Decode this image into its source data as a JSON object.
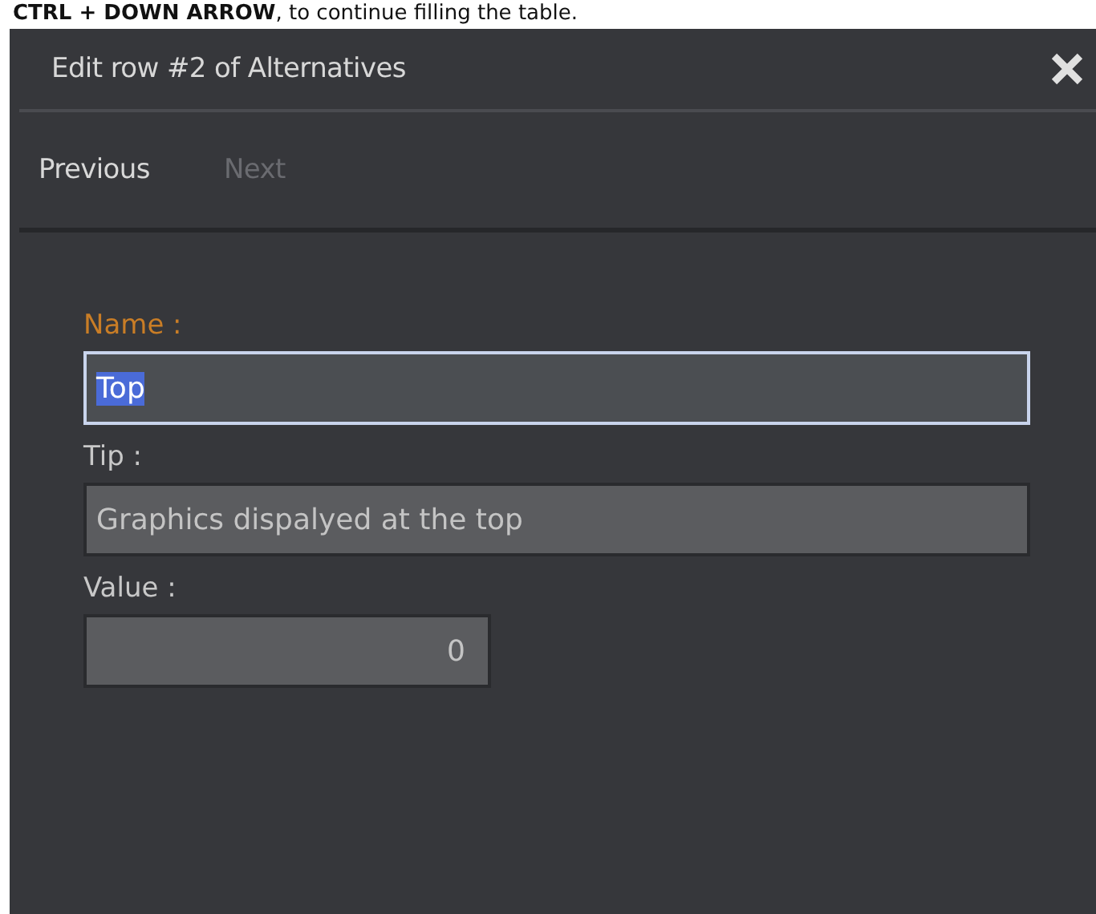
{
  "instruction": "**CTRL + DOWN ARROW**, to continue filling the table.",
  "dialog": {
    "title": "Edit row #2 of Alternatives",
    "nav": [
      {
        "label": "Previous",
        "disabled": false
      },
      {
        "label": "Next",
        "disabled": true
      }
    ],
    "fields": [
      {
        "label": "Name :",
        "value": "Top",
        "focused": true,
        "kind": "text"
      },
      {
        "label": "Tip :",
        "value": "Graphics dispalyed at the top",
        "focused": false,
        "kind": "text"
      },
      {
        "label": "Value :",
        "value": "0",
        "focused": false,
        "kind": "number"
      }
    ]
  }
}
